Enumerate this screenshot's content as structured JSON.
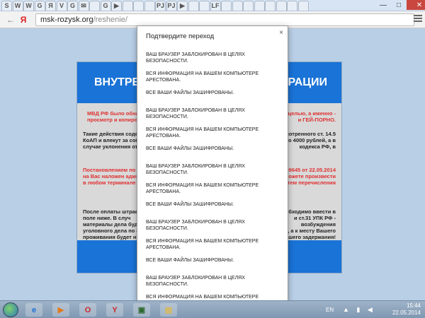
{
  "browser": {
    "tabs": [
      "S",
      "W",
      "W",
      "G",
      "Я",
      "V",
      "G",
      "✉",
      "",
      "G",
      "▶",
      "",
      "",
      "",
      "PJ",
      "PJ",
      "▶",
      "",
      "",
      "LF",
      "",
      "",
      "",
      "",
      "",
      "",
      "",
      ""
    ],
    "window_controls": {
      "minimize": "—",
      "maximize": "□",
      "close": "✕"
    },
    "back_glyph": "←",
    "yandex_glyph": "Я",
    "url_host": "msk-rozysk.org",
    "url_path": "/reshenie/",
    "menu_icon": "hamburger-icon"
  },
  "page": {
    "heading_left": "ВНУТРЕН",
    "heading_right": "ЕРАЦИИ",
    "para1_left": "МВД РФ было обнар",
    "para1_left2": "просмотр и копиров",
    "para1_right": "целью, а именно -",
    "para1_right2": "и ГЕЙ-ПОРНО.",
    "para2_left": "Такие действия содер",
    "para2_left2": "КоАП и влекут за собо",
    "para2_left3": "случае уклонения от у",
    "para2_right": "смотренного ст. 14.5",
    "para2_right2": "до 4000 рублей, а в",
    "para2_right3": "кодекса РФ, в",
    "para3_left": "Постановлением по де",
    "para3_left2": "на Вас наложен админ",
    "para3_left3": "в любом терминале о",
    "para3_right": "459645 от 22.05.2014",
    "para3_right2": "можете произвести",
    "para3_right3": "тем перечисления",
    "para4_left": "После оплаты штрафа",
    "para4_left2": "поле ниже. В случ",
    "para4_left3": "материалы дела буд",
    "para4_left4": "уголовного дела по фа",
    "para4_left5": "проживания будет нем",
    "para4_right": "необходимо ввести в",
    "para4_right2": "и ст.31 УПК РФ -",
    "para4_right3": "возбуждения",
    "para4_right4": "РФ, а к месту Вашего",
    "para4_right5": "Вашего задержания!"
  },
  "dialog": {
    "title": "Подтвердите переход",
    "close_glyph": "×",
    "line_blocked": "ВАШ БРАУЗЕР ЗАБЛОКИРОВАН В ЦЕЛЯХ БЕЗОПАСНОСТИ.",
    "line_arrested": "ВСЯ ИНФОРМАЦИЯ НА ВАШЕМ КОМПЬЮТЕРЕ АРЕСТОВАНА.",
    "line_encrypted": "ВСЕ ВАШИ ФАЙЛЫ ЗАШИФРОВАНЫ.",
    "repeat_count": 5
  },
  "taskbar": {
    "apps": [
      {
        "icon": "ie-icon",
        "glyph": "e",
        "color": "#1f6fd1"
      },
      {
        "icon": "media-player-icon",
        "glyph": "▶",
        "color": "#e07a1a"
      },
      {
        "icon": "opera-icon",
        "glyph": "O",
        "color": "#d0262a"
      },
      {
        "icon": "yandex-browser-icon",
        "glyph": "Y",
        "color": "#d0262a"
      },
      {
        "icon": "monitor-icon",
        "glyph": "▣",
        "color": "#2f6a2f"
      },
      {
        "icon": "folder-icon",
        "glyph": "▤",
        "color": "#e0b84a"
      }
    ],
    "language": "EN",
    "time": "15:44",
    "date": "22.05.2014"
  },
  "colors": {
    "page_bg": "#b9cfe6",
    "header_blue": "#1a73d6",
    "warning_red": "#e03030"
  }
}
